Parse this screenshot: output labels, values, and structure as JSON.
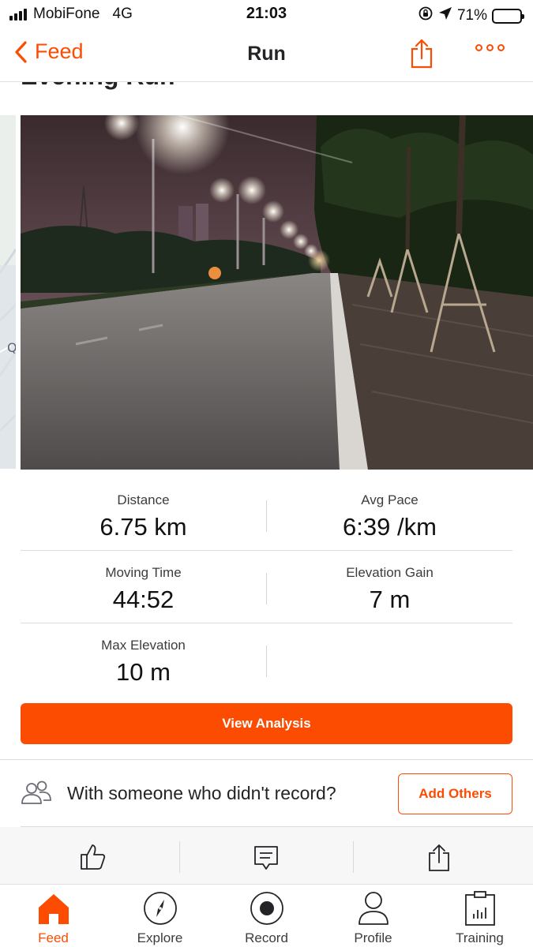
{
  "status_bar": {
    "carrier": "MobiFone",
    "network": "4G",
    "time": "21:03",
    "battery_percent": "71%",
    "battery_level": 0.71
  },
  "nav": {
    "back_label": "Feed",
    "title": "Run"
  },
  "activity": {
    "title": "Evening Run"
  },
  "stats": {
    "distance": {
      "label": "Distance",
      "value": "6.75 km"
    },
    "avg_pace": {
      "label": "Avg Pace",
      "value": "6:39 /km"
    },
    "moving_time": {
      "label": "Moving Time",
      "value": "44:52"
    },
    "elevation_gain": {
      "label": "Elevation Gain",
      "value": "7 m"
    },
    "max_elevation": {
      "label": "Max Elevation",
      "value": "10 m"
    }
  },
  "buttons": {
    "view_analysis": "View Analysis",
    "add_others": "Add Others"
  },
  "with_others": {
    "prompt": "With someone who didn't record?"
  },
  "actions": {
    "icons": [
      "thumbs-up-icon",
      "comment-icon",
      "share-icon"
    ]
  },
  "tabs": [
    {
      "label": "Feed",
      "icon": "home-icon",
      "active": true
    },
    {
      "label": "Explore",
      "icon": "compass-icon",
      "active": false
    },
    {
      "label": "Record",
      "icon": "record-icon",
      "active": false
    },
    {
      "label": "Profile",
      "icon": "profile-icon",
      "active": false
    },
    {
      "label": "Training",
      "icon": "training-icon",
      "active": false
    }
  ],
  "colors": {
    "brand": "#fc4c02",
    "text": "#242428",
    "divider": "#dcdcdc"
  }
}
